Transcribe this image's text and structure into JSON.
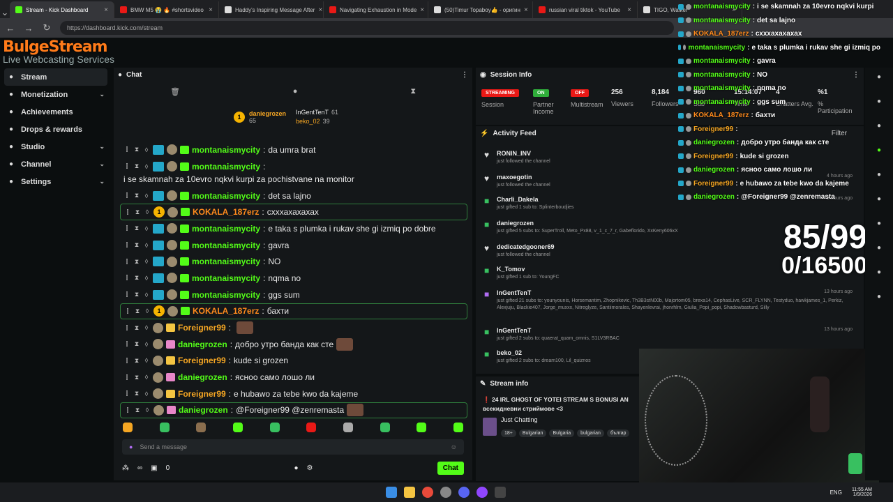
{
  "browser": {
    "tabs": [
      {
        "title": "Stream - Kick Dashboard",
        "active": true
      },
      {
        "title": "BMW M5 😭 🔥 #shortsvideo"
      },
      {
        "title": "Haddy's Inspiring Message After"
      },
      {
        "title": "Navigating Exhaustion in Mode"
      },
      {
        "title": "(50)Timur Topaboy👍 - оригин"
      },
      {
        "title": "russian viral tiktok - YouTube"
      },
      {
        "title": "TIGO, Walker"
      }
    ],
    "url": "https://dashboard.kick.com/stream"
  },
  "logo": {
    "line1": "BulgeStream",
    "line2": "Live Webcasting Services"
  },
  "sidebar": {
    "items": [
      {
        "label": "Stream",
        "icon": "stream-icon",
        "active": true
      },
      {
        "label": "Monetization",
        "icon": "dollar-icon",
        "chev": "⌄"
      },
      {
        "label": "Achievements",
        "icon": "trophy-icon"
      },
      {
        "label": "Drops & rewards",
        "icon": "gift-icon"
      },
      {
        "label": "Studio",
        "icon": "studio-icon",
        "chev": "⌄"
      },
      {
        "label": "Channel",
        "icon": "channel-icon",
        "chev": "⌄"
      },
      {
        "label": "Settings",
        "icon": "gear-icon",
        "chev": "⌄"
      }
    ]
  },
  "chat": {
    "title": "Chat",
    "pinned": {
      "top": {
        "rank": "1",
        "name": "daniegrozen",
        "count": "65"
      },
      "second": {
        "name": "InGentTenT",
        "count": "61"
      },
      "third": {
        "name": "beko_02",
        "count": "39"
      }
    },
    "messages": [
      {
        "user": "montanaismycity",
        "text": "da umra brat",
        "color": "#53fc18",
        "gift": "g"
      },
      {
        "user": "montanaismycity",
        "text": "i se skamnah za 10evro nqkvi kurpi za pochistvane na monitor",
        "color": "#53fc18",
        "gift": "g",
        "wrap": true
      },
      {
        "user": "montanaismycity",
        "text": "det sa lajno",
        "color": "#53fc18",
        "gift": "g"
      },
      {
        "user": "KOKALA_187erz",
        "text": "схххахахахах",
        "color": "#ff8a1c",
        "gift": "g",
        "hl": true,
        "coin": "1"
      },
      {
        "user": "montanaismycity",
        "text": "e taka s plumka i rukav she gi izmiq po dobre",
        "color": "#53fc18",
        "gift": "g"
      },
      {
        "user": "montanaismycity",
        "text": "gavra",
        "color": "#53fc18",
        "gift": "g"
      },
      {
        "user": "montanaismycity",
        "text": "NO",
        "color": "#53fc18",
        "gift": "g"
      },
      {
        "user": "montanaismycity",
        "text": "nqma no",
        "color": "#53fc18",
        "gift": "g"
      },
      {
        "user": "montanaismycity",
        "text": "ggs sum",
        "color": "#53fc18",
        "gift": "g"
      },
      {
        "user": "KOKALA_187erz",
        "text": "бахти",
        "color": "#ff8a1c",
        "gift": "g",
        "hl": true,
        "coin": "1"
      },
      {
        "user": "Foreigner99",
        "text": "",
        "color": "#f5a623",
        "gift": "y",
        "emote": true
      },
      {
        "user": "daniegrozen",
        "text": "добро утро банда как сте",
        "color": "#53fc18",
        "gift": "p",
        "emote": true
      },
      {
        "user": "Foreigner99",
        "text": "kude si grozen",
        "color": "#f5a623",
        "gift": "y"
      },
      {
        "user": "daniegrozen",
        "text": "ясноо само лошо ли",
        "color": "#53fc18",
        "gift": "p"
      },
      {
        "user": "Foreigner99",
        "text": "e hubawo za tebe kwo da kajeme",
        "color": "#f5a623",
        "gift": "y"
      },
      {
        "user": "daniegrozen",
        "text": "@Foreigner99 @zenremasta",
        "color": "#53fc18",
        "gift": "p",
        "hl": true,
        "emote": true
      }
    ],
    "input_placeholder": "Send a message",
    "infinity": "∞",
    "count": "0",
    "send_label": "Chat"
  },
  "session": {
    "title": "Session Info",
    "items": [
      {
        "pill": "STREAMING",
        "pillColor": "#e91916",
        "label": "Session"
      },
      {
        "pill": "ON",
        "pillColor": "#2fae3a",
        "label": "Partner Income"
      },
      {
        "pill": "OFF",
        "pillColor": "#e91916",
        "label": "Multistream"
      },
      {
        "value": "256",
        "label": "Viewers"
      },
      {
        "value": "8,184",
        "label": "Followers"
      },
      {
        "value": "960",
        "label": "Sub"
      },
      {
        "value": "15:14:07",
        "label": "Time"
      },
      {
        "value": "4",
        "label": "Chatters Avg."
      },
      {
        "value": "%1",
        "label": "% Participation"
      }
    ]
  },
  "activity": {
    "title": "Activity Feed",
    "filter": "Filter",
    "items": [
      {
        "name": "RONIN_INV",
        "sub": "just followed the channel",
        "icon": "heart-icon",
        "time": ""
      },
      {
        "name": "maxoegotin",
        "sub": "just followed the channel",
        "icon": "heart-icon",
        "time": "4 hours ago"
      },
      {
        "name": "Charli_Dakela",
        "sub": "just gifted 1 sub to: Splinterboudjies",
        "icon": "gift-icon",
        "time": "9 hours ago"
      },
      {
        "name": "daniegrozen",
        "sub": "just gifted 5 subs to: SuperTroll, Meto_Px88, v_1_c_7_r, Gabeflorido, XxKeny606xX",
        "icon": "gift-icon",
        "time": ""
      },
      {
        "name": "dedicatedgooner69",
        "sub": "just followed the channel",
        "icon": "heart-icon",
        "time": ""
      },
      {
        "name": "K_Tomov",
        "sub": "just gifted 1 sub to: YoungFC",
        "icon": "gift-icon",
        "time": ""
      },
      {
        "name": "InGentTenT",
        "sub": "just gifted 21 subs to: younyounis, Horsemantim, Zhopnikevic, Th3B3stN00b, Majortom05, brexa14, CephasLive, SCR_FLYNN, Testyduo, hawkjames_1, Perkiz, Alexjuju, Blackie407, Jorge_muxxx, Nitreglyze, Santiimorales, Shayenlevrai, jhonrhlm, Giulia_Popi_popi, Shadowbasturd, Silly",
        "icon": "gift-icon",
        "time": "13 hours ago"
      },
      {
        "name": "InGentTenT",
        "sub": "just gifted 2 subs to: quaerat_quam_omnis, S1LV3RBAC",
        "icon": "gift-icon",
        "time": "13 hours ago"
      },
      {
        "name": "beko_02",
        "sub": "just gifted 2 subs to: dream100, Lil_quiznos",
        "icon": "gift-icon",
        "time": "13 hours ago"
      }
    ]
  },
  "streaminfo": {
    "title": "Stream info",
    "streamtitle": "24 IRL GHOST OF YOTEI STREAM S BONUSI AN",
    "line2": "всекидневни стриймове <3",
    "category": "Just Chatting",
    "tags": [
      "18+",
      "Bulgarian",
      "Bulgaria",
      "bulgarian",
      "българ"
    ]
  },
  "overlay": {
    "messages": [
      {
        "user": "montanaismycity",
        "text": "i se skamnah za 10evro nqkvi kurpi",
        "color": "#53fc18"
      },
      {
        "user": "montanaismycity",
        "text": "det sa lajno",
        "color": "#53fc18"
      },
      {
        "user": "KOKALA_187erz",
        "text": "схххахахахах",
        "color": "#ff8a1c"
      },
      {
        "user": "montanaismycity",
        "text": "e taka s plumka i rukav she gi izmiq po",
        "color": "#53fc18"
      },
      {
        "user": "montanaismycity",
        "text": "gavra",
        "color": "#53fc18"
      },
      {
        "user": "montanaismycity",
        "text": "NO",
        "color": "#53fc18"
      },
      {
        "user": "montanaismycity",
        "text": "nqma no",
        "color": "#53fc18"
      },
      {
        "user": "montanaismycity",
        "text": "ggs sum",
        "color": "#53fc18"
      },
      {
        "user": "KOKALA_187erz",
        "text": "бахти",
        "color": "#ff8a1c"
      },
      {
        "user": "Foreigner99",
        "text": "",
        "color": "#f5a623"
      },
      {
        "user": "daniegrozen",
        "text": "добро утро банда как сте",
        "color": "#53fc18"
      },
      {
        "user": "Foreigner99",
        "text": "kude si grozen",
        "color": "#f5a623"
      },
      {
        "user": "daniegrozen",
        "text": "ясноо само лошо ли",
        "color": "#53fc18"
      },
      {
        "user": "Foreigner99",
        "text": "e hubawo za tebe kwo da kajeme",
        "color": "#f5a623"
      },
      {
        "user": "daniegrozen",
        "text": "@Foreigner99 @zenremasta",
        "color": "#53fc18"
      }
    ],
    "goal1": "85/99",
    "goal2": "0/16500"
  },
  "taskbar": {
    "lang": "ENG",
    "time": "11:55 AM",
    "date": "1/9/2026"
  }
}
